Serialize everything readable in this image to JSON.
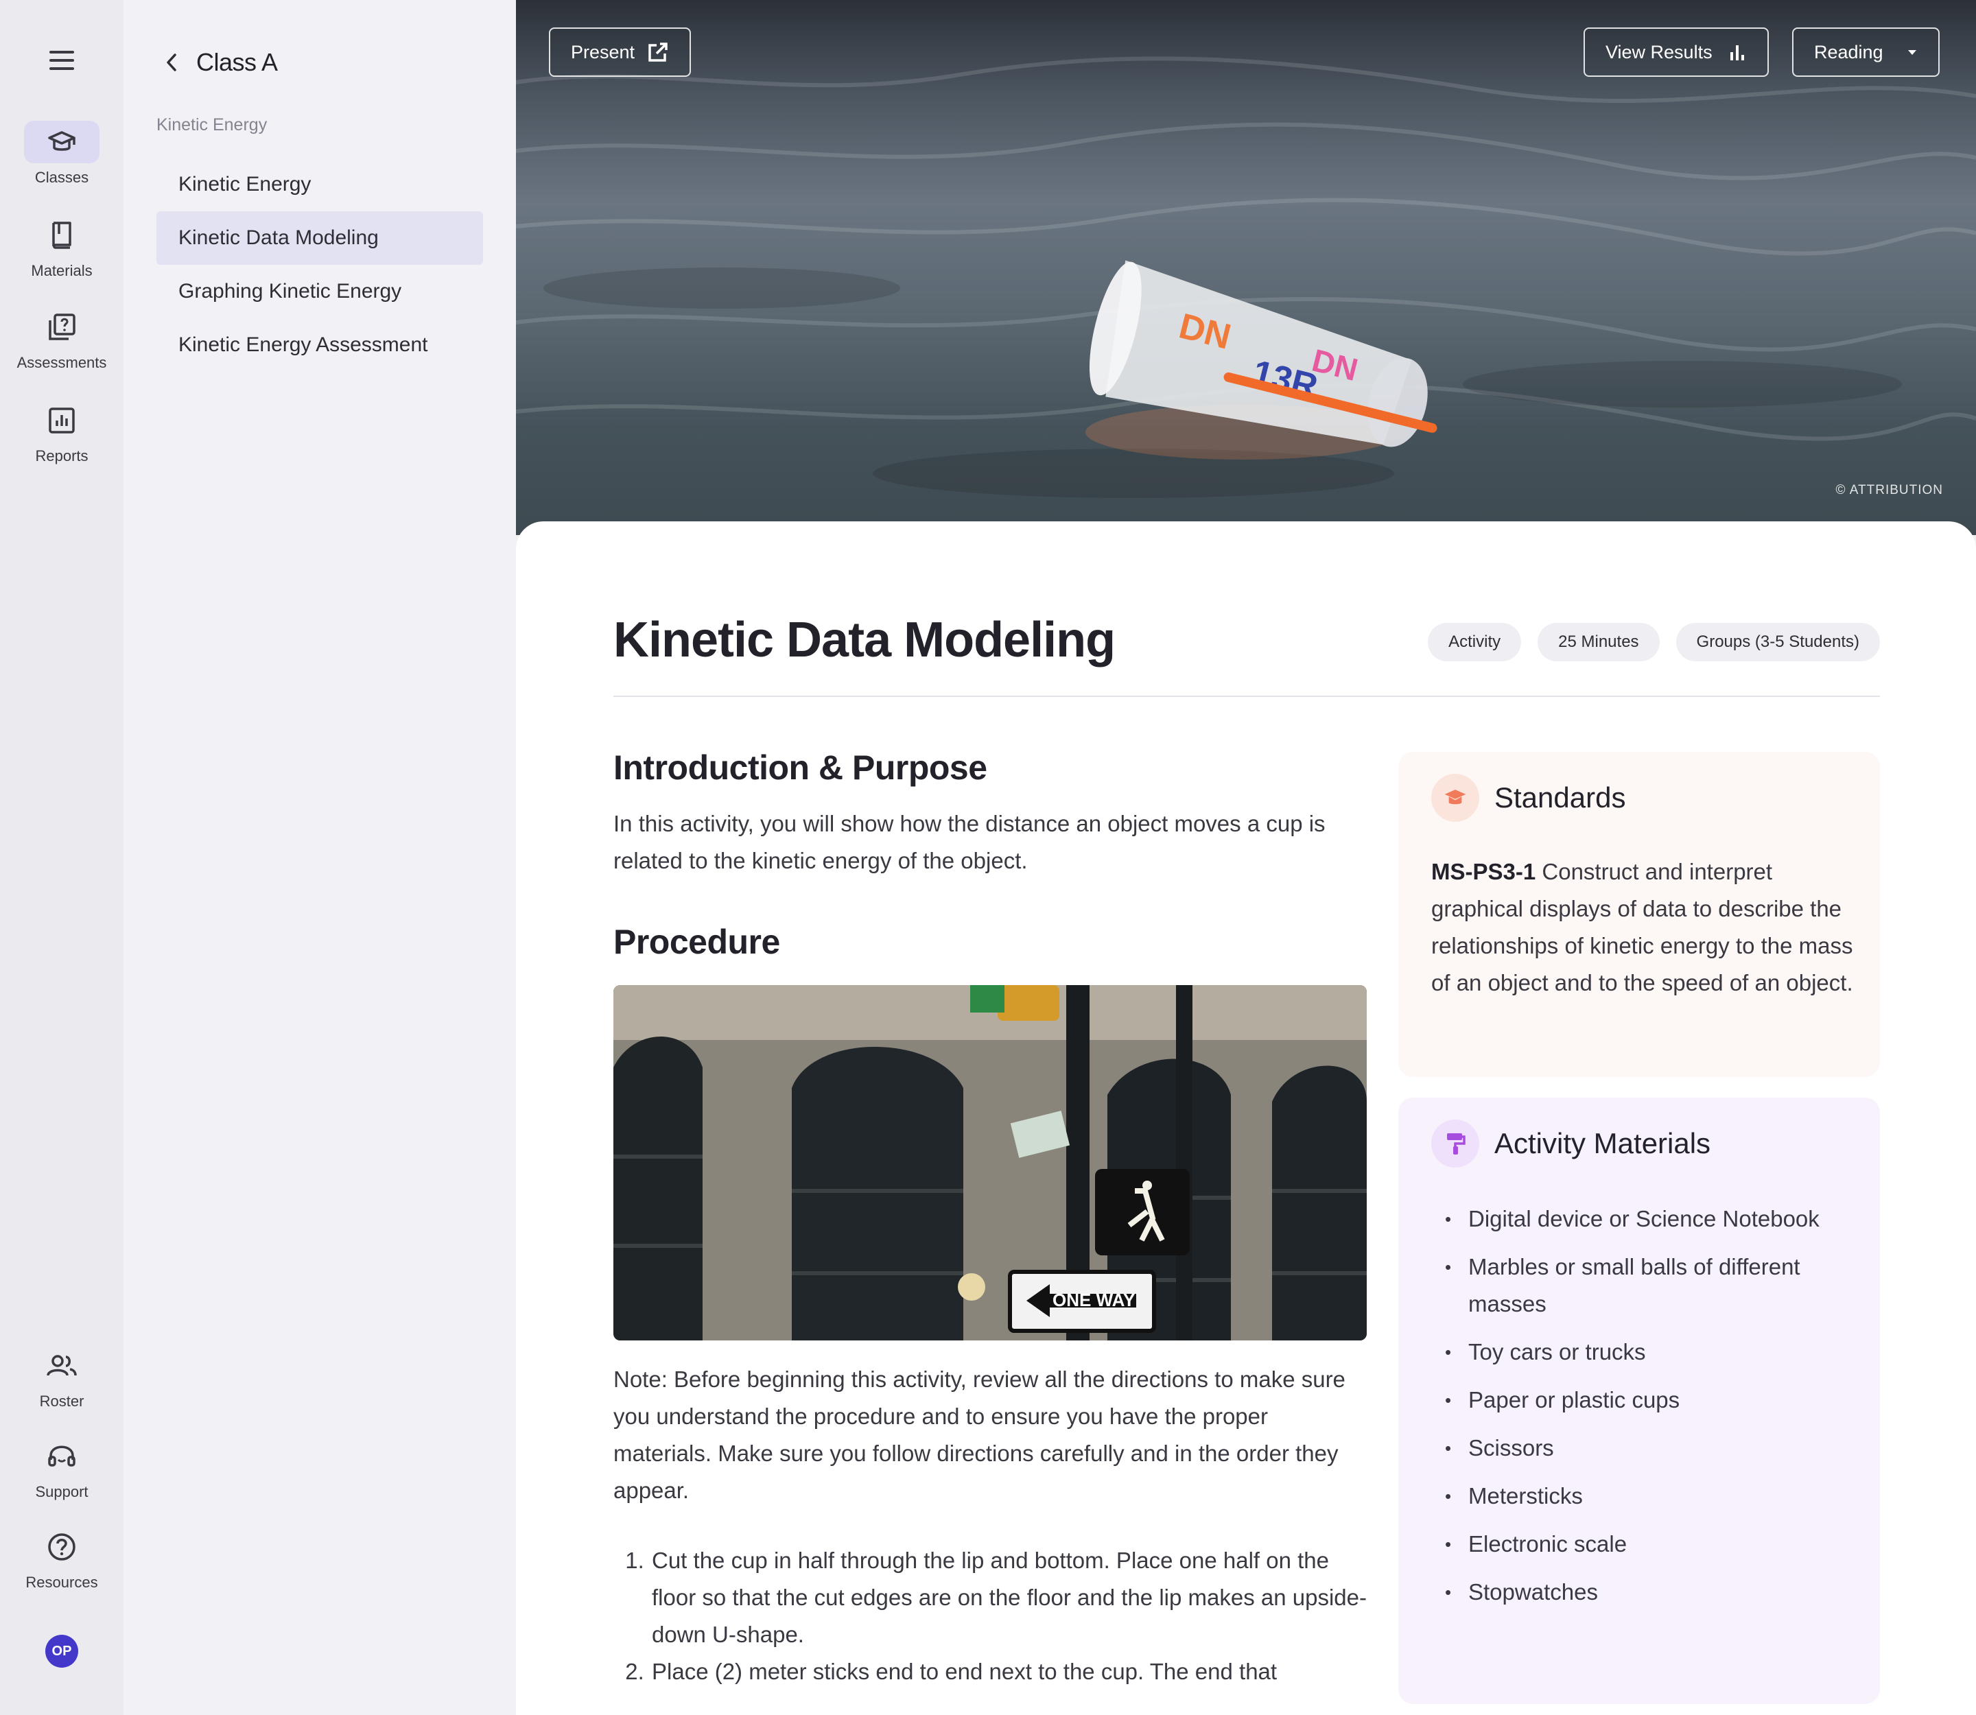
{
  "rail": {
    "items": [
      {
        "label": "Classes",
        "icon": "graduation-cap-icon"
      },
      {
        "label": "Materials",
        "icon": "book-icon"
      },
      {
        "label": "Assessments",
        "icon": "quiz-icon"
      },
      {
        "label": "Reports",
        "icon": "report-chart-icon"
      }
    ],
    "bottom": [
      {
        "label": "Roster",
        "icon": "people-icon"
      },
      {
        "label": "Support",
        "icon": "headset-icon"
      },
      {
        "label": "Resources",
        "icon": "help-circle-icon"
      }
    ],
    "avatar": "OP"
  },
  "subnav": {
    "title": "Class A",
    "section": "Kinetic Energy",
    "items": [
      "Kinetic Energy",
      "Kinetic Data Modeling",
      "Graphing Kinetic Energy",
      "Kinetic Energy Assessment"
    ]
  },
  "hero": {
    "present": "Present",
    "view_results": "View Results",
    "reading": "Reading",
    "attribution": "© ATTRIBUTION"
  },
  "lesson": {
    "title": "Kinetic Data Modeling",
    "chips": [
      "Activity",
      "25 Minutes",
      "Groups (3-5 Students)"
    ],
    "intro_heading": "Introduction & Purpose",
    "intro_text": "In this activity, you will show how the distance an object moves a cup is related to the kinetic energy of the object.",
    "procedure_heading": "Procedure",
    "note": "Note: Before beginning this activity, review all the directions to make sure you understand the procedure and to ensure you have the proper materials. Make sure you follow directions carefully and in the order they appear.",
    "steps": [
      "Cut the cup in half through the lip and bottom. Place one half on the floor so that the cut edges are on the floor and the lip makes an upside-down U-shape.",
      "Place (2) meter sticks end to end next to the cup. The end that"
    ]
  },
  "standards": {
    "heading": "Standards",
    "code": "MS-PS3-1",
    "text": " Construct and interpret graphical displays of data to describe the relationships of kinetic energy to the mass of an object and to the speed of an object."
  },
  "materials": {
    "heading": "Activity Materials",
    "items": [
      "Digital device or Science Notebook",
      "Marbles or small balls of different masses",
      "Toy cars or trucks",
      "Paper or plastic cups",
      "Scissors",
      "Metersticks",
      "Electronic scale",
      "Stopwatches"
    ]
  },
  "colors": {
    "accent": "#4338ca",
    "active_bg": "#e3e2f3",
    "standards_icon": "#f07a5a",
    "materials_icon": "#a64de0"
  }
}
